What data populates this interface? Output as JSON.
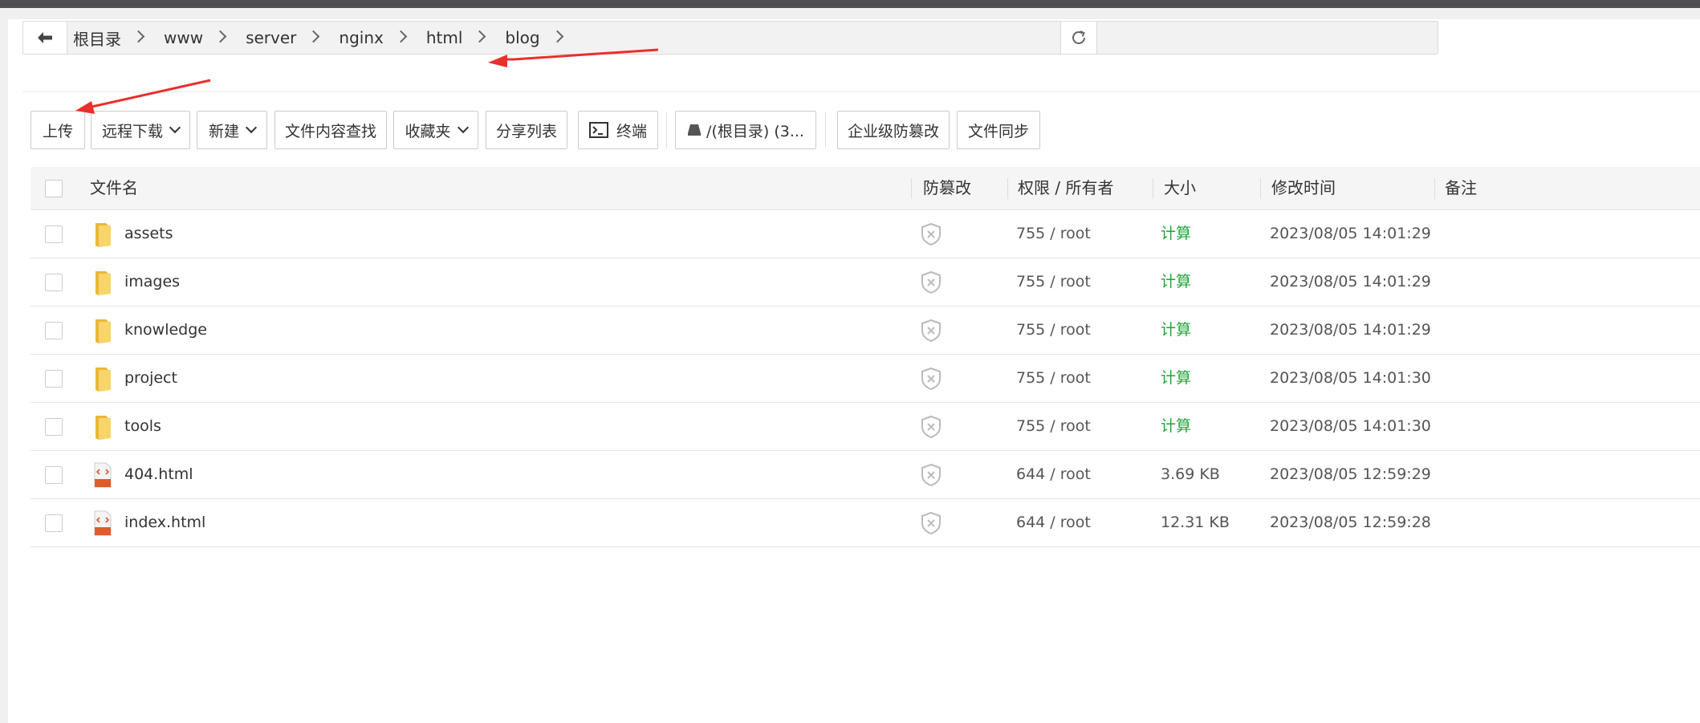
{
  "path": {
    "segments": [
      "根目录",
      "www",
      "server",
      "nginx",
      "html",
      "blog"
    ]
  },
  "toolbar": {
    "upload": "上传",
    "remote_download": "远程下载",
    "new": "新建",
    "content_search": "文件内容查找",
    "favorites": "收藏夹",
    "share_list": "分享列表",
    "terminal": "终端",
    "disk": "/(根目录) (3...",
    "tamper_proof": "企业级防篡改",
    "file_sync": "文件同步"
  },
  "table": {
    "headers": {
      "name": "文件名",
      "tamper": "防篡改",
      "permission": "权限 / 所有者",
      "size": "大小",
      "mtime": "修改时间",
      "remark": "备注"
    },
    "rows": [
      {
        "name": "assets",
        "type": "folder",
        "permission": "755 / root",
        "size": "计算",
        "mtime": "2023/08/05 14:01:29"
      },
      {
        "name": "images",
        "type": "folder",
        "permission": "755 / root",
        "size": "计算",
        "mtime": "2023/08/05 14:01:29"
      },
      {
        "name": "knowledge",
        "type": "folder",
        "permission": "755 / root",
        "size": "计算",
        "mtime": "2023/08/05 14:01:29"
      },
      {
        "name": "project",
        "type": "folder",
        "permission": "755 / root",
        "size": "计算",
        "mtime": "2023/08/05 14:01:30"
      },
      {
        "name": "tools",
        "type": "folder",
        "permission": "755 / root",
        "size": "计算",
        "mtime": "2023/08/05 14:01:30"
      },
      {
        "name": "404.html",
        "type": "html",
        "permission": "644 / root",
        "size": "3.69 KB",
        "mtime": "2023/08/05 12:59:29"
      },
      {
        "name": "index.html",
        "type": "html",
        "permission": "644 / root",
        "size": "12.31 KB",
        "mtime": "2023/08/05 12:59:28"
      }
    ]
  },
  "colors": {
    "accent_green": "#20a53a",
    "annotation_red": "#e8302c",
    "folder_yellow": "#f5c842"
  },
  "icons": {
    "back": "arrow-left-icon",
    "refresh": "refresh-icon",
    "terminal": "terminal-icon",
    "disk": "disk-icon",
    "folder": "folder-icon",
    "html": "html-file-icon",
    "tamper": "shield-icon"
  }
}
